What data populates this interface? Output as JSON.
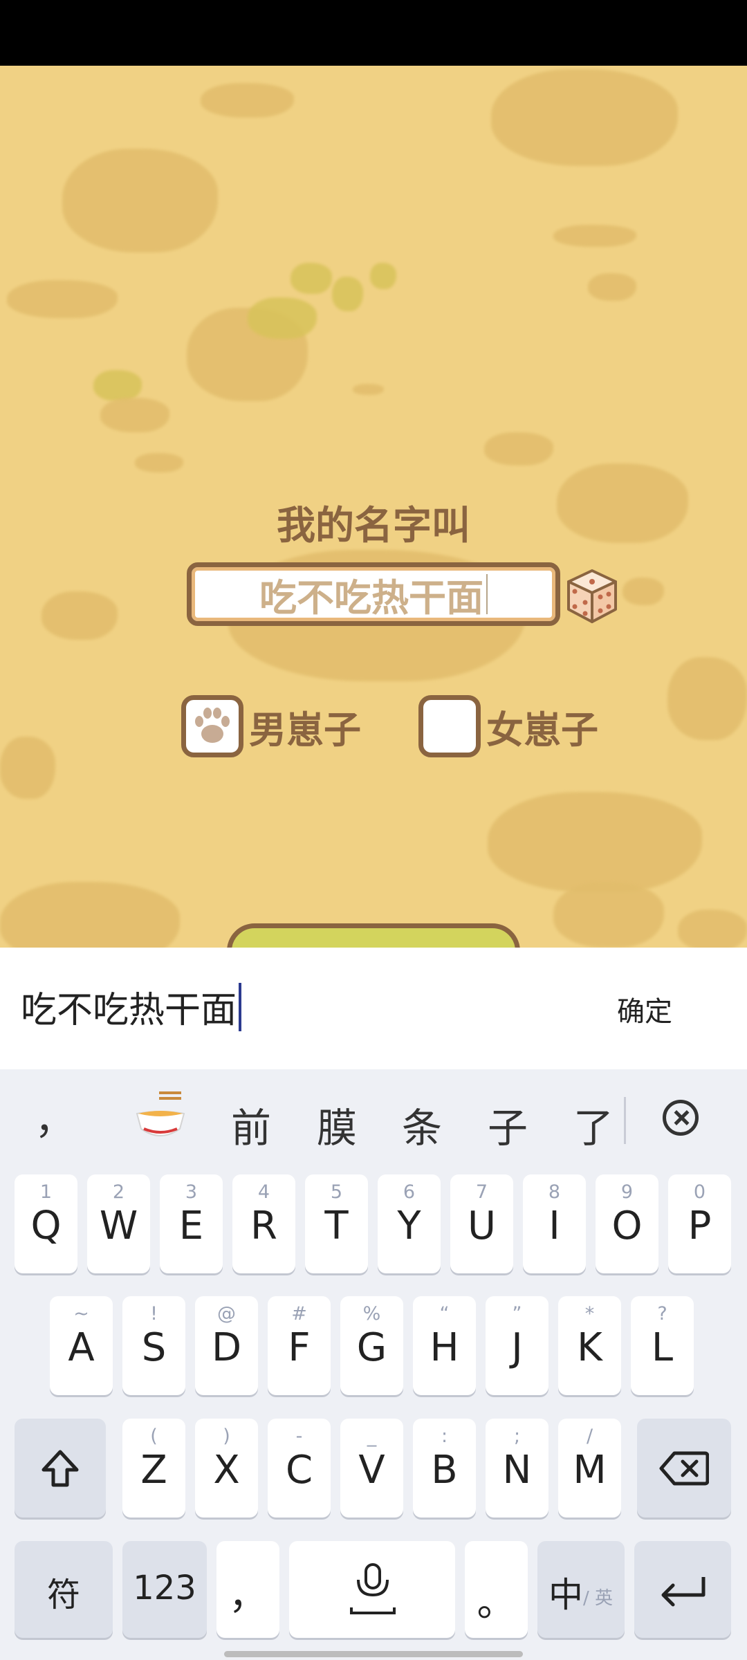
{
  "game": {
    "title": "我的名字叫",
    "name_value": "吃不吃热干面",
    "dice_icon": "dice-icon",
    "genders": [
      {
        "label": "男崽子",
        "selected": true
      },
      {
        "label": "女崽子",
        "selected": false
      }
    ]
  },
  "input_bar": {
    "text": "吃不吃热干面",
    "confirm_label": "确定"
  },
  "keyboard": {
    "candidates": [
      "，",
      "前",
      "膜",
      "条",
      "子",
      "了"
    ],
    "emoji_candidate": "noodle-bowl-emoji",
    "row1": [
      {
        "sub": "1",
        "main": "Q"
      },
      {
        "sub": "2",
        "main": "W"
      },
      {
        "sub": "3",
        "main": "E"
      },
      {
        "sub": "4",
        "main": "R"
      },
      {
        "sub": "5",
        "main": "T"
      },
      {
        "sub": "6",
        "main": "Y"
      },
      {
        "sub": "7",
        "main": "U"
      },
      {
        "sub": "8",
        "main": "I"
      },
      {
        "sub": "9",
        "main": "O"
      },
      {
        "sub": "0",
        "main": "P"
      }
    ],
    "row2": [
      {
        "sub": "~",
        "main": "A"
      },
      {
        "sub": "!",
        "main": "S"
      },
      {
        "sub": "@",
        "main": "D"
      },
      {
        "sub": "#",
        "main": "F"
      },
      {
        "sub": "%",
        "main": "G"
      },
      {
        "sub": "“",
        "main": "H"
      },
      {
        "sub": "”",
        "main": "J"
      },
      {
        "sub": "*",
        "main": "K"
      },
      {
        "sub": "?",
        "main": "L"
      }
    ],
    "row3": [
      {
        "sub": "(",
        "main": "Z"
      },
      {
        "sub": ")",
        "main": "X"
      },
      {
        "sub": "-",
        "main": "C"
      },
      {
        "sub": "_",
        "main": "V"
      },
      {
        "sub": ":",
        "main": "B"
      },
      {
        "sub": ";",
        "main": "N"
      },
      {
        "sub": "/",
        "main": "M"
      }
    ],
    "symbols_label": "符",
    "numbers_label": "123",
    "comma_label": "，",
    "period_label": "。",
    "lang_main": "中",
    "lang_sub": "/ 英"
  }
}
